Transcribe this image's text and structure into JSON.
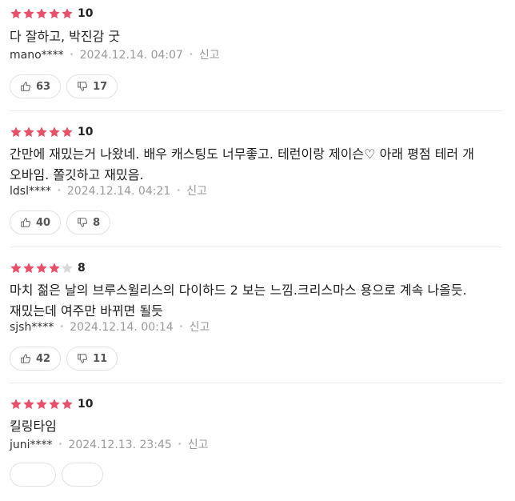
{
  "colors": {
    "star_on": "#e8506a",
    "star_off": "#d8d8d8"
  },
  "icons": {
    "like": "thumbs-up-icon",
    "dislike": "thumbs-down-icon"
  },
  "reviews": [
    {
      "rating_stars": 5,
      "score": "10",
      "comment_lines": [
        "다 잘하고, 박진감 굿"
      ],
      "user": "mano****",
      "date": "2024.12.14. 04:07",
      "report": "신고",
      "likes": "63",
      "dislikes": "17"
    },
    {
      "rating_stars": 5,
      "score": "10",
      "comment_lines": [
        "간만에 재밌는거 나왔네. 배우 캐스팅도 너무좋고. 테런이랑 제이슨♡ 아래 평점 테러 개",
        "오바임. 쫄깃하고 재밌음."
      ],
      "user": "ldsl****",
      "date": "2024.12.14. 04:21",
      "report": "신고",
      "likes": "40",
      "dislikes": "8"
    },
    {
      "rating_stars": 4,
      "score": "8",
      "comment_lines": [
        "마치 젊은 날의 브루스윌리스의 다이하드 2 보는 느낌.크리스마스 용으로 계속 나올듯.",
        "재밌는데 여주만 바뀌면 될듯"
      ],
      "user": "sjsh****",
      "date": "2024.12.14. 00:14",
      "report": "신고",
      "likes": "42",
      "dislikes": "11"
    },
    {
      "rating_stars": 5,
      "score": "10",
      "comment_lines": [
        "킬링타임"
      ],
      "user": "juni****",
      "date": "2024.12.13. 23:45",
      "report": "신고",
      "likes": "",
      "dislikes": ""
    }
  ]
}
